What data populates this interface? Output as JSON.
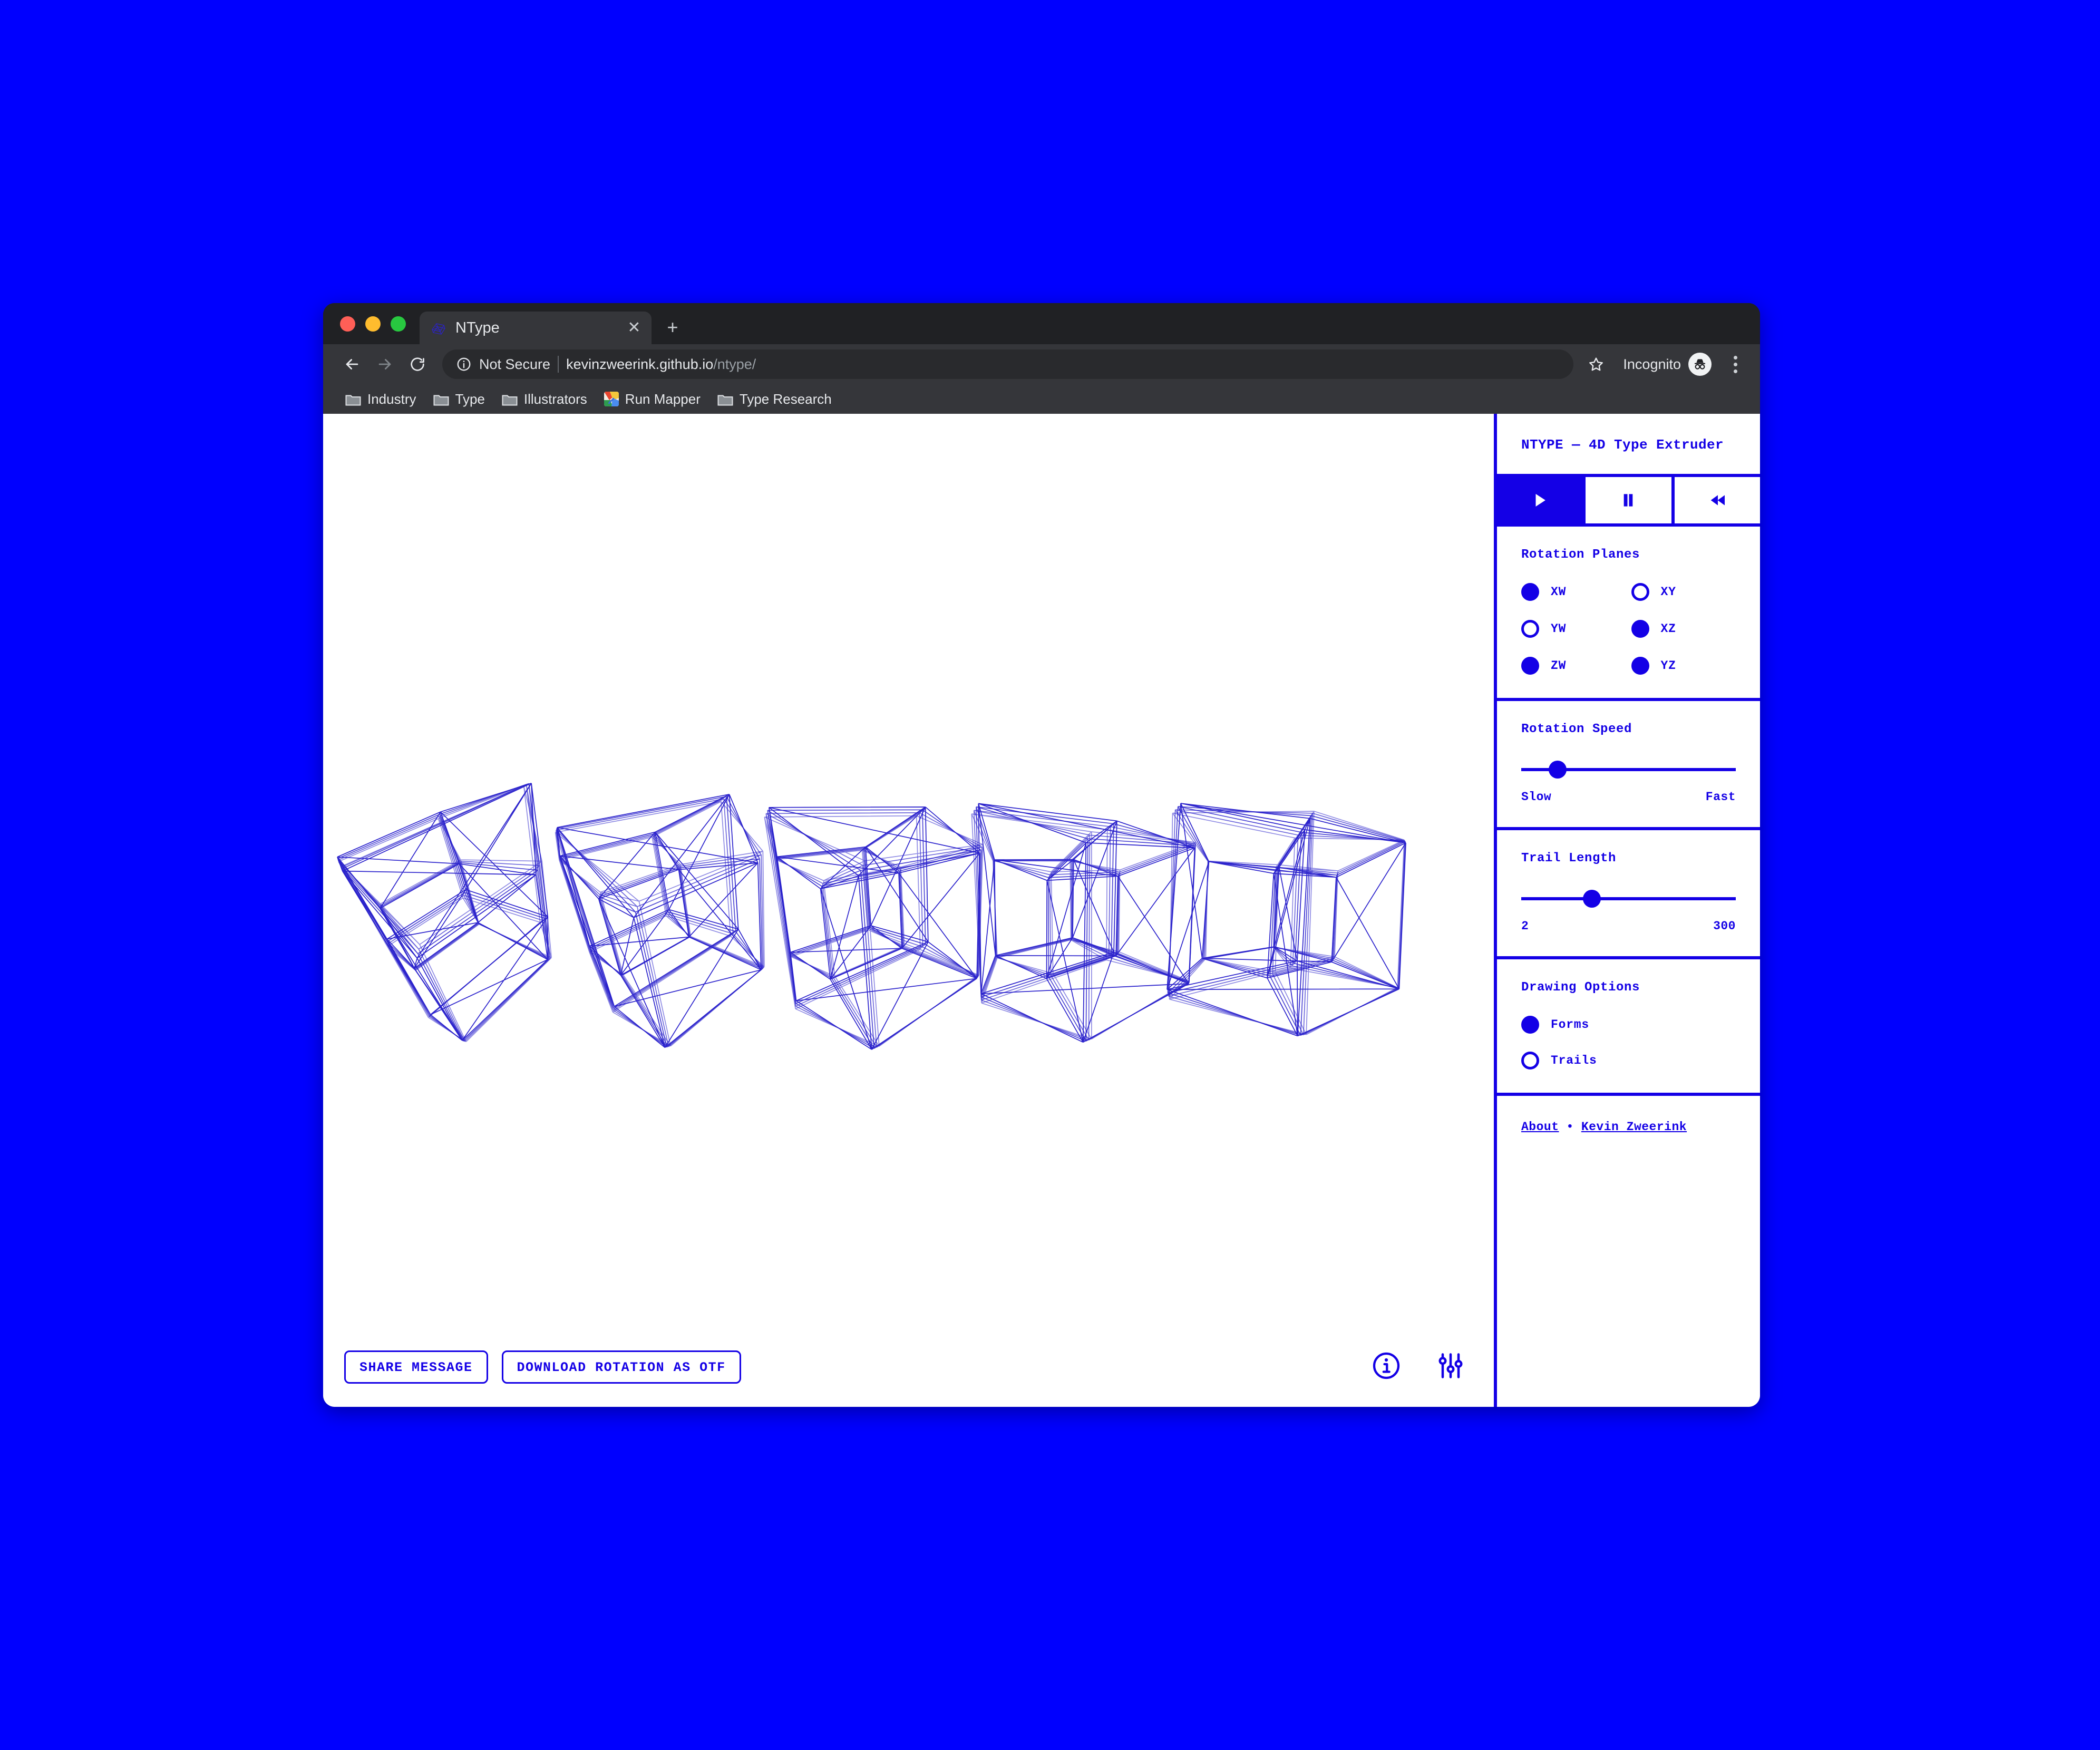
{
  "browser": {
    "tab": {
      "title": "NType",
      "favicon": "wireframe-favicon",
      "close_label": "✕"
    },
    "new_tab_label": "+",
    "security_label": "Not Secure",
    "url_host": "kevinzweerink.github.io",
    "url_path": "/ntype/",
    "profile_label": "Incognito",
    "bookmarks": [
      {
        "label": "Industry",
        "icon": "folder-icon"
      },
      {
        "label": "Type",
        "icon": "folder-icon"
      },
      {
        "label": "Illustrators",
        "icon": "folder-icon"
      },
      {
        "label": "Run Mapper",
        "icon": "site-favicon"
      },
      {
        "label": "Type Research",
        "icon": "folder-icon"
      }
    ]
  },
  "sidebar": {
    "title": "NTYPE — 4D Type Extruder",
    "transport": [
      {
        "name": "play",
        "glyph": "▶",
        "active": true
      },
      {
        "name": "pause",
        "glyph": "▐▌",
        "active": false
      },
      {
        "name": "rewind",
        "glyph": "◀◀",
        "active": false
      }
    ],
    "rotation_planes": {
      "label": "Rotation Planes",
      "options": [
        {
          "label": "XW",
          "selected": true
        },
        {
          "label": "XY",
          "selected": false
        },
        {
          "label": "YW",
          "selected": false
        },
        {
          "label": "XZ",
          "selected": true
        },
        {
          "label": "ZW",
          "selected": true
        },
        {
          "label": "YZ",
          "selected": true
        }
      ]
    },
    "rotation_speed": {
      "label": "Rotation Speed",
      "min_label": "Slow",
      "max_label": "Fast",
      "value_percent": 17
    },
    "trail_length": {
      "label": "Trail Length",
      "min_label": "2",
      "max_label": "300",
      "value_percent": 33
    },
    "drawing_options": {
      "label": "Drawing Options",
      "options": [
        {
          "label": "Forms",
          "selected": true
        },
        {
          "label": "Trails",
          "selected": false
        }
      ]
    },
    "footer": {
      "about_label": "About",
      "separator": "•",
      "author_label": "Kevin Zweerink"
    }
  },
  "canvas": {
    "share_button": "SHARE MESSAGE",
    "download_button": "DOWNLOAD ROTATION AS OTF",
    "info_icon": "info-circle-icon",
    "settings_icon": "sliders-icon",
    "shape_count": 5,
    "stroke_color": "#2b22cc"
  },
  "colors": {
    "accent_blue": "#1400e6",
    "page_background": "#0000ff",
    "canvas_background": "#ffffff",
    "chrome_tabstrip": "#202124",
    "chrome_toolbar": "#35363a"
  }
}
